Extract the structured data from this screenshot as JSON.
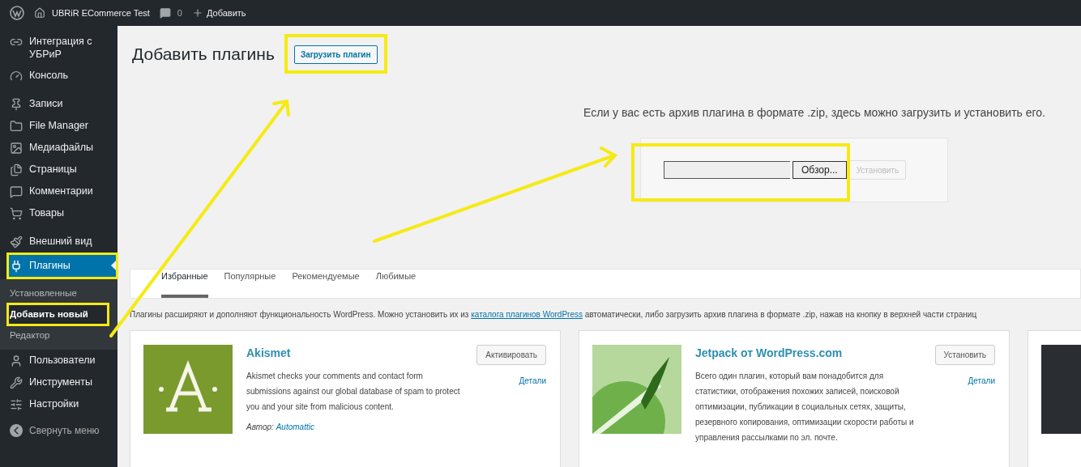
{
  "admin_bar": {
    "site_name": "UBRiR ECommerce Test",
    "comments_count": "0",
    "new_label": "Добавить"
  },
  "sidebar": {
    "groups": [
      {
        "items": [
          {
            "label": "Интеграция с УБРиР",
            "selected": false
          },
          {
            "label": "Консоль",
            "selected": false
          }
        ]
      },
      {
        "items": [
          {
            "label": "Записи",
            "selected": false
          },
          {
            "label": "File Manager",
            "selected": false
          },
          {
            "label": "Медиафайлы",
            "selected": false
          },
          {
            "label": "Страницы",
            "selected": false
          },
          {
            "label": "Комментарии",
            "selected": false
          },
          {
            "label": "Товары",
            "selected": false
          }
        ]
      },
      {
        "items": [
          {
            "label": "Внешний вид",
            "selected": false
          },
          {
            "label": "Плагины",
            "selected": true,
            "children": [
              {
                "label": "Установленные",
                "selected": false
              },
              {
                "label": "Добавить новый",
                "selected": true
              },
              {
                "label": "Редактор",
                "selected": false
              }
            ]
          },
          {
            "label": "Пользователи",
            "selected": false
          },
          {
            "label": "Инструменты",
            "selected": false
          },
          {
            "label": "Настройки",
            "selected": false
          }
        ]
      }
    ],
    "collapse_label": "Свернуть меню"
  },
  "page": {
    "title": "Добавить плагинь",
    "upload_button": "Загрузить плагин"
  },
  "upload": {
    "help": "Если у вас есть архив плагина в формате .zip, здесь можно загрузить и установить его.",
    "browse_button": "Обзор...",
    "install_button": "Установить",
    "install_disabled": true
  },
  "tabs": [
    {
      "label": "Избранные",
      "selected": true
    },
    {
      "label": "Популярные",
      "selected": false
    },
    {
      "label": "Рекомендуемые",
      "selected": false
    },
    {
      "label": "Любимые",
      "selected": false
    }
  ],
  "notice": {
    "before": "Плагины расширяют и дополняют функциональность WordPress. Можно установить их из ",
    "link": "каталога плагинов WordPress",
    "after": " автоматически, либо загрузить архив плагина в формате .zip, нажав на кнопку в верхней части страниц"
  },
  "cards": [
    {
      "name": "Akismet",
      "action": "Активировать",
      "details": "Детали",
      "description": "Akismet checks your comments and contact form submissions against our global database of spam to protect you and your site from malicious content.",
      "author_label": "Автор:",
      "author": "Automattic"
    },
    {
      "name": "Jetpack от WordPress.com",
      "action": "Установить",
      "details": "Детали",
      "description": "Всего один плагин, который вам понадобится для статистики, отображения похожих записей, поисковой оптимизации, публикации в социальных сетях, защиты, резервного копирования, оптимизации скорости работы и управления рассылками по эл. почте."
    }
  ]
}
